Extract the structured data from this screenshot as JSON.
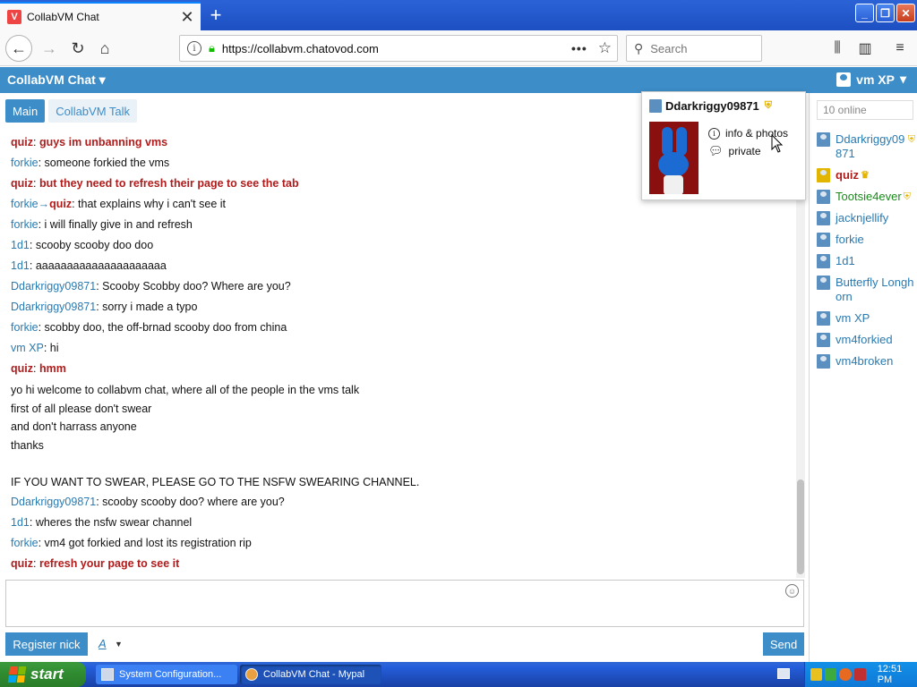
{
  "browser": {
    "tab_title": "CollabVM Chat",
    "tab_favicon_letter": "V",
    "url": "https://collabvm.chatovod.com",
    "url_host": "collabvm.chatovod.com",
    "search_placeholder": "Search"
  },
  "app": {
    "title": "CollabVM Chat",
    "current_user": "vm XP",
    "accent_color": "#3d8dc9"
  },
  "chat_tabs": [
    {
      "label": "Main",
      "active": true
    },
    {
      "label": "CollabVM Talk",
      "active": false
    }
  ],
  "messages": [
    {
      "nick": "quiz",
      "text": "guys im unbanning vms",
      "style": "bold-red"
    },
    {
      "nick": "forkie",
      "text": "someone forkied the vms",
      "style": "normal"
    },
    {
      "nick": "quiz",
      "text": "but they need to refresh their page to see the tab",
      "style": "bold-red"
    },
    {
      "nick": "forkie",
      "to": "quiz",
      "text": "that explains why i can't see it",
      "style": "private"
    },
    {
      "nick": "forkie",
      "text": "i will finally give in and refresh",
      "style": "normal"
    },
    {
      "nick": "1d1",
      "text": "scooby scooby doo doo",
      "style": "normal"
    },
    {
      "nick": "1d1",
      "text": "aaaaaaaaaaaaaaaaaaaaa",
      "style": "normal"
    },
    {
      "nick": "Ddarkriggy09871",
      "text": "Scooby Scobby doo? Where are you?",
      "style": "normal"
    },
    {
      "nick": "Ddarkriggy09871",
      "text": "sorry i made a typo",
      "style": "normal"
    },
    {
      "nick": "forkie",
      "text": "scobby doo, the off-brnad scooby doo from china",
      "style": "normal"
    },
    {
      "nick": "vm XP",
      "text": "hi",
      "style": "normal"
    },
    {
      "nick": "quiz",
      "text": "hmm",
      "style": "bold-red"
    }
  ],
  "notice_lines": [
    "yo hi welcome to collabvm chat, where all of the people in the vms talk",
    "first of all please don't swear",
    "and don't harrass anyone",
    "thanks",
    "",
    "IF YOU WANT TO SWEAR, PLEASE GO TO THE NSFW SWEARING CHANNEL."
  ],
  "messages_after": [
    {
      "nick": "Ddarkriggy09871",
      "text": "scooby scooby doo? where are you?",
      "style": "normal"
    },
    {
      "nick": "1d1",
      "text": "wheres the nsfw swear channel",
      "style": "normal"
    },
    {
      "nick": "forkie",
      "text": "vm4 got forkied and lost its registration rip",
      "style": "normal"
    },
    {
      "nick": "quiz",
      "text": "refresh your page to see it",
      "style": "bold-red"
    }
  ],
  "buttons": {
    "register": "Register nick",
    "format": "A",
    "send": "Send"
  },
  "sidebar": {
    "online_count": "10 online",
    "users": [
      {
        "name": "Ddarkriggy09871",
        "style": "normal",
        "badge": "shield"
      },
      {
        "name": "quiz",
        "style": "red",
        "badge": "crown"
      },
      {
        "name": "Tootsie4ever",
        "style": "green",
        "badge": "shield"
      },
      {
        "name": "jacknjellify",
        "style": "normal",
        "badge": ""
      },
      {
        "name": "forkie",
        "style": "normal",
        "badge": ""
      },
      {
        "name": "1d1",
        "style": "normal",
        "badge": ""
      },
      {
        "name": "Butterfly Longhorn",
        "style": "normal",
        "badge": ""
      },
      {
        "name": "vm XP",
        "style": "normal",
        "badge": ""
      },
      {
        "name": "vm4forkied",
        "style": "normal",
        "badge": ""
      },
      {
        "name": "vm4broken",
        "style": "normal",
        "badge": ""
      }
    ]
  },
  "popup": {
    "name": "Ddarkriggy09871",
    "link_info": "info & photos",
    "link_private": "private"
  },
  "taskbar": {
    "start": "start",
    "items": [
      "System Configuration...",
      "CollabVM Chat - Mypal"
    ],
    "clock": "12:51 PM"
  }
}
